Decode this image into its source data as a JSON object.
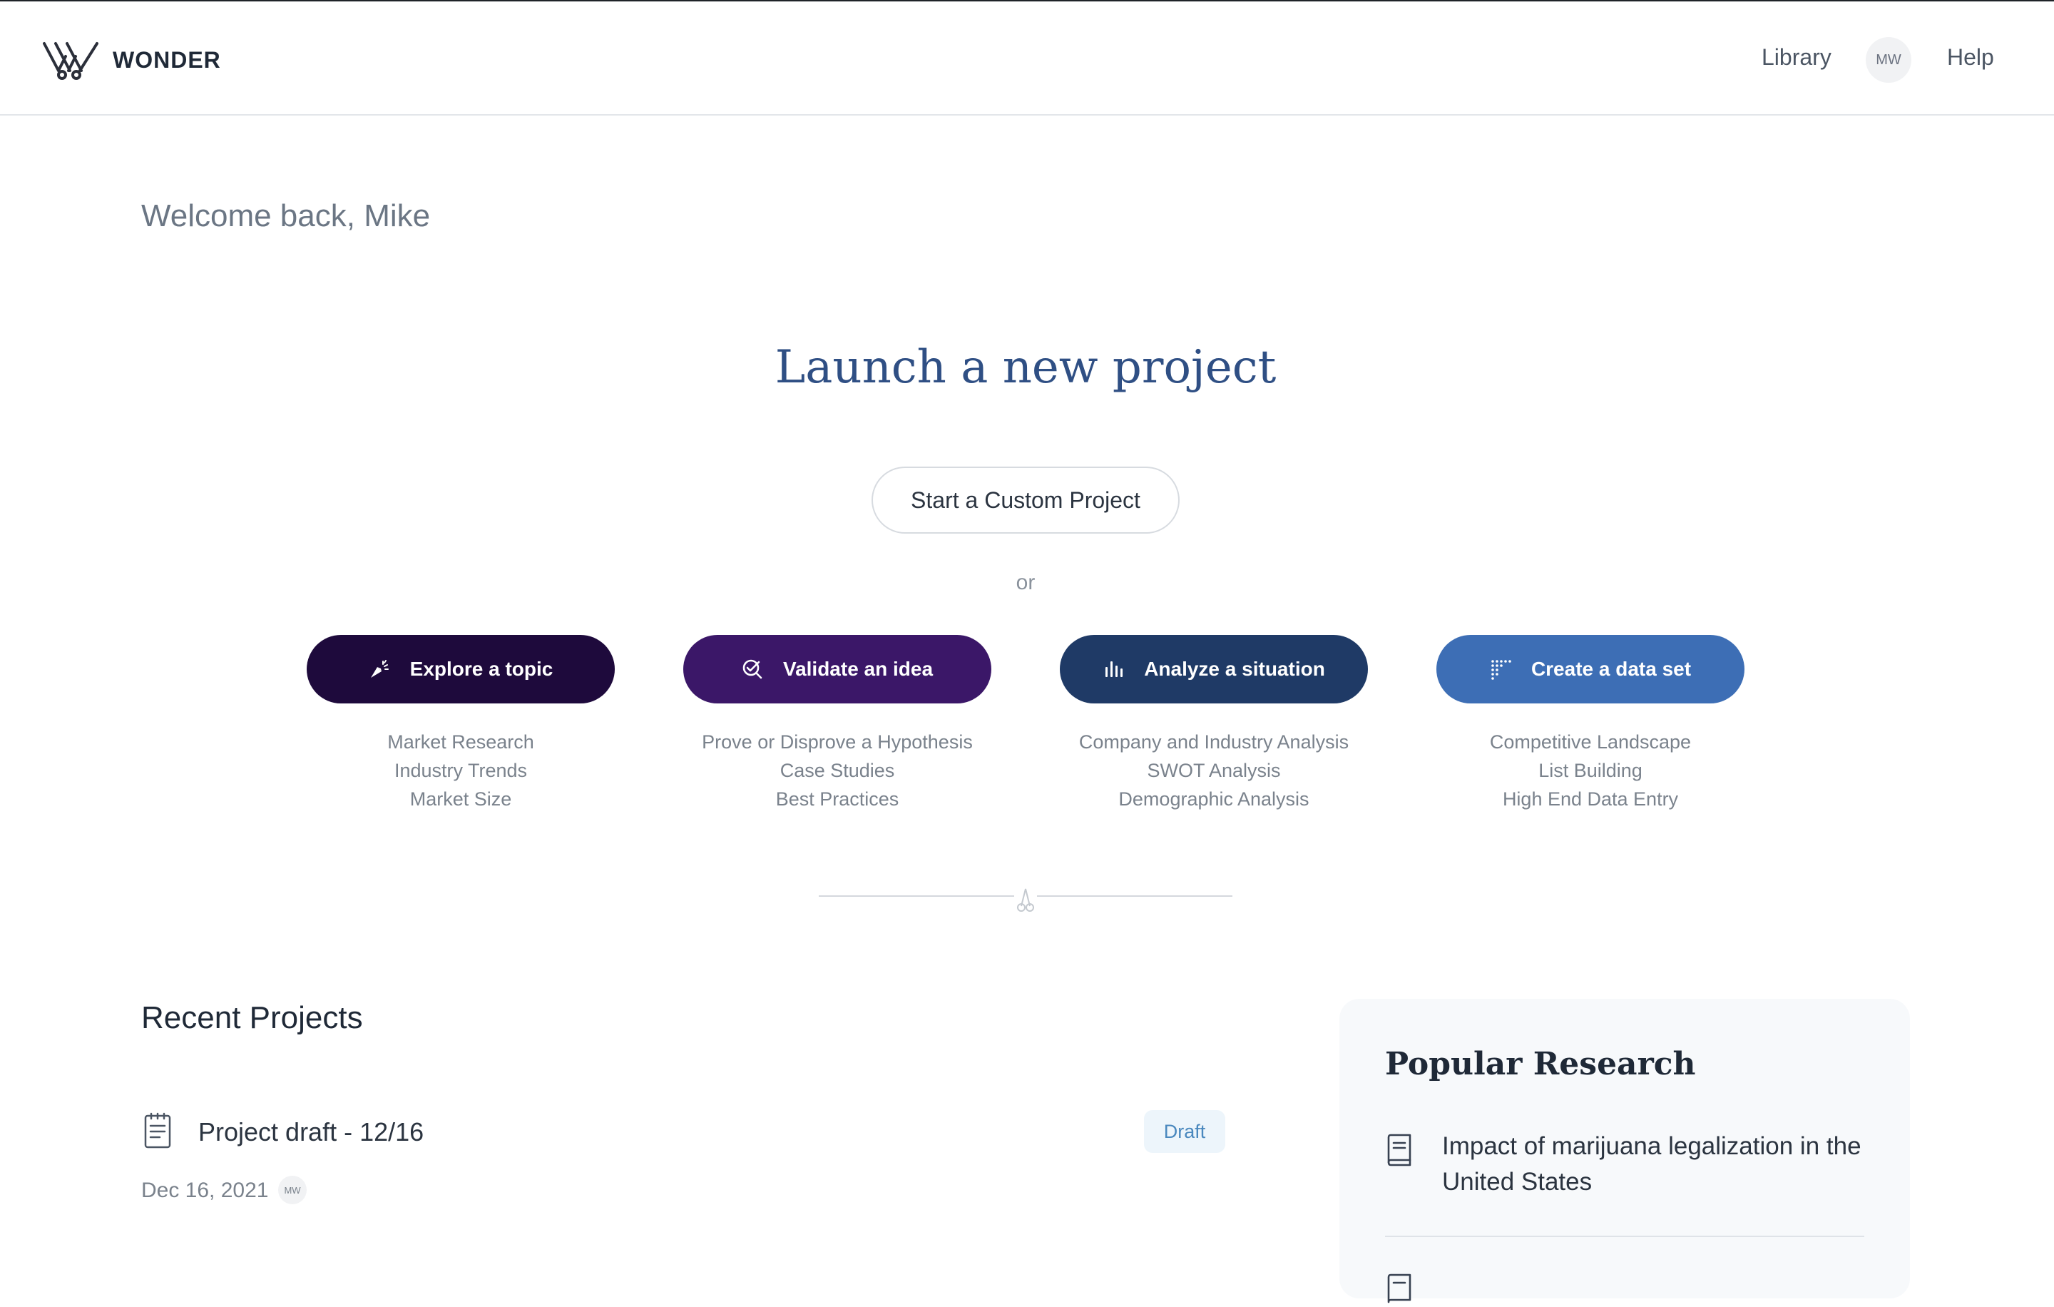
{
  "header": {
    "brand": "WONDER",
    "nav": {
      "library": "Library",
      "avatar_initials": "MW",
      "help": "Help"
    }
  },
  "welcome": "Welcome back, Mike",
  "launch": {
    "title": "Launch a new project",
    "custom_button": "Start a Custom Project",
    "or": "or"
  },
  "categories": [
    {
      "label": "Explore a topic",
      "icon": "sparkle-arrow-icon",
      "color": "#1e0a3c",
      "items": [
        "Market Research",
        "Industry Trends",
        "Market Size"
      ]
    },
    {
      "label": "Validate an idea",
      "icon": "check-magnifier-icon",
      "color": "#3b1768",
      "items": [
        "Prove or Disprove a Hypothesis",
        "Case Studies",
        "Best Practices"
      ]
    },
    {
      "label": "Analyze a situation",
      "icon": "bar-chart-icon",
      "color": "#1f3a66",
      "items": [
        "Company and Industry Analysis",
        "SWOT Analysis",
        "Demographic Analysis"
      ]
    },
    {
      "label": "Create a data set",
      "icon": "dot-grid-icon",
      "color": "#3d6eb5",
      "items": [
        "Competitive Landscape",
        "List Building",
        "High End Data Entry"
      ]
    }
  ],
  "recent": {
    "title": "Recent Projects",
    "projects": [
      {
        "name": "Project draft - 12/16",
        "status": "Draft",
        "date": "Dec 16, 2021",
        "owner_initials": "MW"
      }
    ]
  },
  "popular": {
    "title": "Popular Research",
    "items": [
      "Impact of marijuana legalization in the United States"
    ]
  }
}
